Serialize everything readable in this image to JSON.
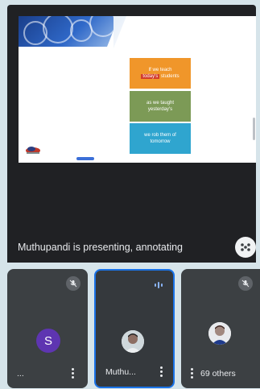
{
  "presenter_status": "Muthupandi is presenting, annotating",
  "slide": {
    "box1_line1": "If we teach",
    "box1_hl": "today's",
    "box1_line2": "students",
    "box2_line1": "as we taught",
    "box2_line2": "yesterday's",
    "box3_line1": "we rob them of",
    "box3_line2": "tomorrow"
  },
  "participants": [
    {
      "initial": "S",
      "name": "...",
      "mic": "muted"
    },
    {
      "name": "Muthu...",
      "mic": "speaking"
    },
    {
      "name": "69 others",
      "mic": "muted"
    }
  ],
  "icons": {
    "more": "more-options-icon",
    "mic_off": "mic-off-icon",
    "speaking": "speaking-icon",
    "kebab": "kebab-menu-icon"
  },
  "colors": {
    "accent": "#1a73e8",
    "avatar_purple": "#5e35b1"
  }
}
